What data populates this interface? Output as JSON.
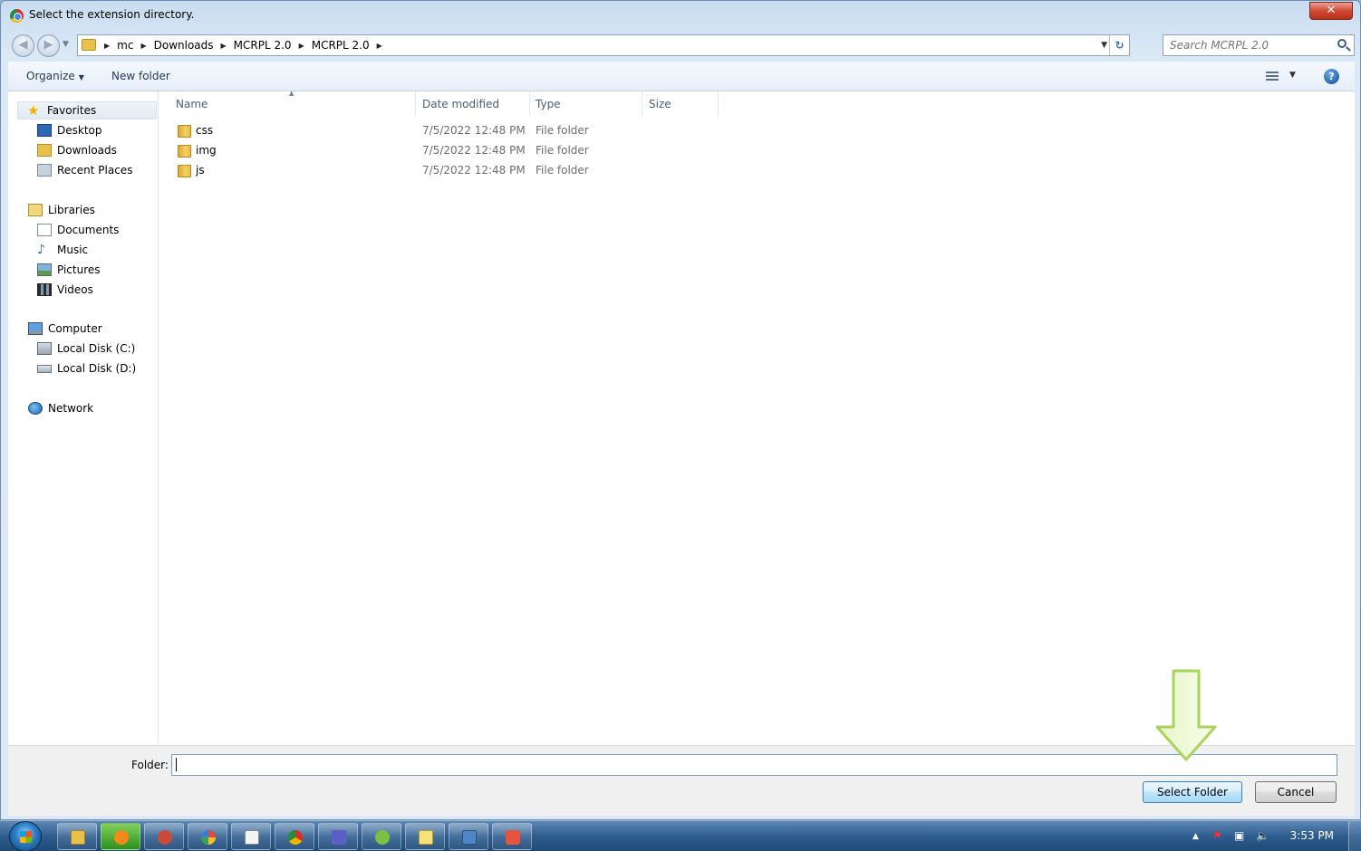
{
  "window": {
    "title": "Select the extension directory.",
    "close_label": "✕"
  },
  "address": {
    "crumbs": [
      "mc",
      "Downloads",
      "MCRPL 2.0",
      "MCRPL 2.0"
    ],
    "search_placeholder": "Search MCRPL 2.0"
  },
  "toolbar": {
    "organize_label": "Organize",
    "new_folder_label": "New folder"
  },
  "sidebar": {
    "favorites": {
      "label": "Favorites",
      "items": [
        "Desktop",
        "Downloads",
        "Recent Places"
      ]
    },
    "libraries": {
      "label": "Libraries",
      "items": [
        "Documents",
        "Music",
        "Pictures",
        "Videos"
      ]
    },
    "computer": {
      "label": "Computer",
      "items": [
        "Local Disk (C:)",
        "Local Disk (D:)"
      ]
    },
    "network": {
      "label": "Network"
    }
  },
  "filelist": {
    "columns": [
      "Name",
      "Date modified",
      "Type",
      "Size"
    ],
    "rows": [
      {
        "name": "css",
        "date": "7/5/2022 12:48 PM",
        "type": "File folder"
      },
      {
        "name": "img",
        "date": "7/5/2022 12:48 PM",
        "type": "File folder"
      },
      {
        "name": "js",
        "date": "7/5/2022 12:48 PM",
        "type": "File folder"
      }
    ]
  },
  "footer": {
    "folder_label": "Folder:",
    "folder_value": "",
    "select_button": "Select Folder",
    "cancel_button": "Cancel"
  },
  "taskbar": {
    "clock": "3:53 PM",
    "pinned_icons": [
      "explorer-icon",
      "media-player-icon",
      "chat-icon",
      "paint-icon",
      "notepad-icon",
      "chrome-icon",
      "teams-icon",
      "messenger-icon",
      "sticky-notes-icon",
      "remote-desktop-icon",
      "snipping-tool-icon"
    ]
  },
  "colors": {
    "accent_blue": "#3c7fb1",
    "annotation_arrow": "#b8e07a"
  }
}
